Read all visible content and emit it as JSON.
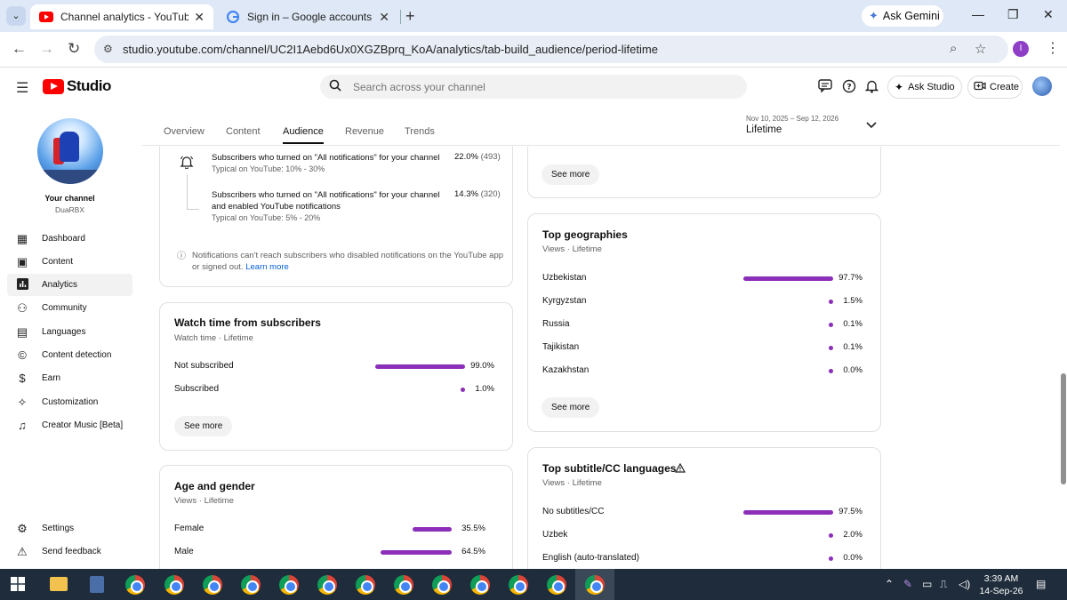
{
  "browser": {
    "tabs": [
      {
        "title": "Channel analytics - YouTube Studio",
        "active": true
      },
      {
        "title": "Sign in – Google accounts",
        "active": false
      }
    ],
    "gemini_label": "Ask Gemini",
    "url": "studio.youtube.com/channel/UC2I1Aebd6Ux0XGZBprq_KoA/analytics/tab-build_audience/period-lifetime",
    "profile_initial": "I"
  },
  "studio": {
    "logo_text": "Studio",
    "search_placeholder": "Search across your channel",
    "ask_studio_label": "Ask Studio",
    "create_label": "Create"
  },
  "sidebar": {
    "your_channel": "Your channel",
    "channel_name": "DuaRBX",
    "items": [
      {
        "label": "Dashboard",
        "icon": "dashboard-icon",
        "active": false
      },
      {
        "label": "Content",
        "icon": "content-icon",
        "active": false
      },
      {
        "label": "Analytics",
        "icon": "analytics-icon",
        "active": true
      },
      {
        "label": "Community",
        "icon": "community-icon",
        "active": false
      },
      {
        "label": "Languages",
        "icon": "languages-icon",
        "active": false
      },
      {
        "label": "Content detection",
        "icon": "content-detection-icon",
        "active": false
      },
      {
        "label": "Earn",
        "icon": "earn-icon",
        "active": false
      },
      {
        "label": "Customization",
        "icon": "customization-icon",
        "active": false
      },
      {
        "label": "Creator Music [Beta]",
        "icon": "creator-music-icon",
        "active": false
      }
    ],
    "bottom": [
      {
        "label": "Settings",
        "icon": "settings-icon"
      },
      {
        "label": "Send feedback",
        "icon": "feedback-icon"
      }
    ]
  },
  "analytics_tabs": [
    "Overview",
    "Content",
    "Audience",
    "Revenue",
    "Trends"
  ],
  "active_tab": "Audience",
  "period": {
    "range": "Nov 10, 2025 – Sep 12, 2026",
    "value": "Lifetime"
  },
  "notifications_card": {
    "rows": [
      {
        "text": "Subscribers who turned on \"All notifications\" for your channel",
        "typical": "Typical on YouTube: 10% - 30%",
        "pct": "22.0%",
        "count": "(493)"
      },
      {
        "text": "Subscribers who turned on \"All notifications\" for your channel and enabled YouTube notifications",
        "typical": "Typical on YouTube: 5% - 20%",
        "pct": "14.3%",
        "count": "(320)"
      }
    ],
    "info": "Notifications can't reach subscribers who disabled notifications on the YouTube app or signed out.",
    "learn_more": "Learn more"
  },
  "watch_time_card": {
    "title": "Watch time from subscribers",
    "subtitle": "Watch time · Lifetime",
    "rows": [
      {
        "label": "Not subscribed",
        "pct": "99.0%",
        "value": 99.0
      },
      {
        "label": "Subscribed",
        "pct": "1.0%",
        "value": 1.0
      }
    ],
    "see_more": "See more"
  },
  "age_gender_card": {
    "title": "Age and gender",
    "subtitle": "Views · Lifetime",
    "rows": [
      {
        "label": "Female",
        "pct": "35.5%",
        "value": 35.5
      },
      {
        "label": "Male",
        "pct": "64.5%",
        "value": 64.5
      }
    ]
  },
  "top_card_see_more": "See more",
  "geographies_card": {
    "title": "Top geographies",
    "subtitle": "Views · Lifetime",
    "rows": [
      {
        "label": "Uzbekistan",
        "pct": "97.7%",
        "value": 97.7
      },
      {
        "label": "Kyrgyzstan",
        "pct": "1.5%",
        "value": 1.5
      },
      {
        "label": "Russia",
        "pct": "0.1%",
        "value": 0.1
      },
      {
        "label": "Tajikistan",
        "pct": "0.1%",
        "value": 0.1
      },
      {
        "label": "Kazakhstan",
        "pct": "0.0%",
        "value": 0.0
      }
    ],
    "see_more": "See more"
  },
  "subtitles_card": {
    "title": "Top subtitle/CC languages",
    "subtitle": "Views · Lifetime",
    "rows": [
      {
        "label": "No subtitles/CC",
        "pct": "97.5%",
        "value": 97.5
      },
      {
        "label": "Uzbek",
        "pct": "2.0%",
        "value": 2.0
      },
      {
        "label": "English (auto-translated)",
        "pct": "0.0%",
        "value": 0.0
      }
    ]
  },
  "taskbar": {
    "time": "3:39 AM",
    "date": "14-Sep-26"
  },
  "colors": {
    "bar": "#8b2eb8",
    "youtube_red": "#ff0000",
    "link": "#065fd4"
  }
}
